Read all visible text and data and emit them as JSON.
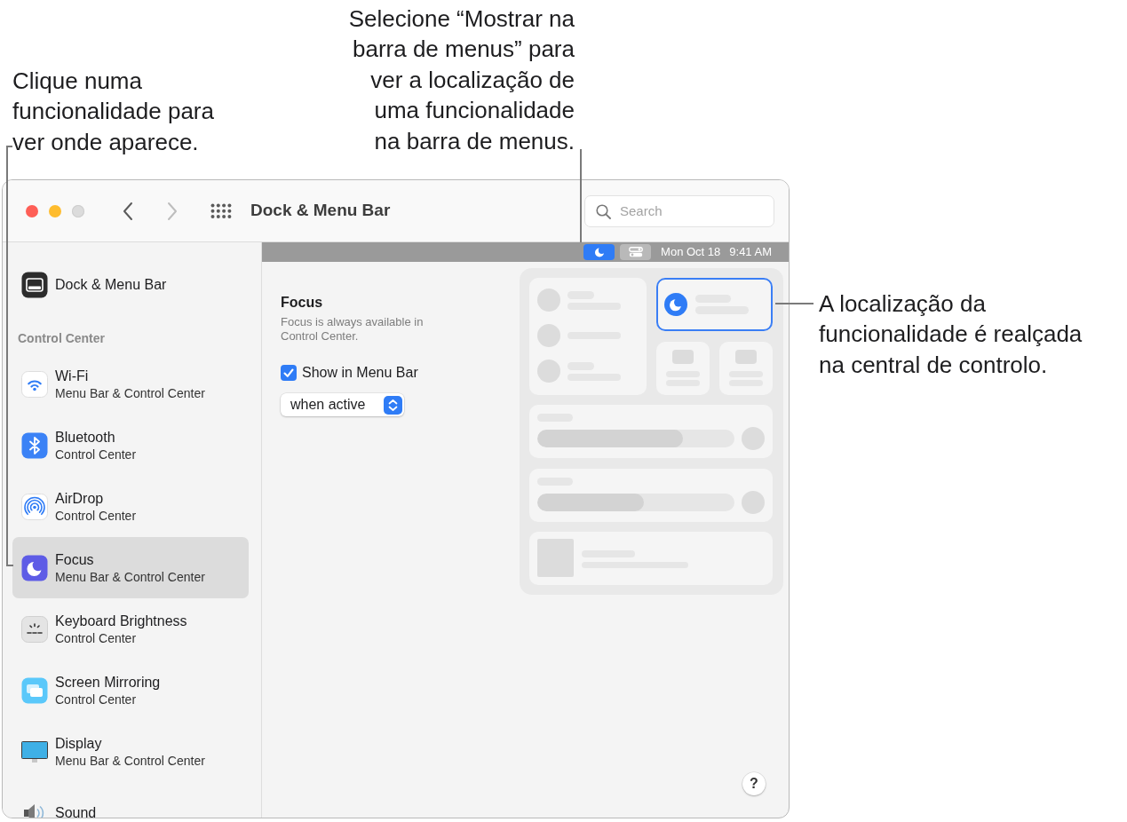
{
  "callouts": [
    {
      "lines": [
        "Clique numa",
        "funcionalidade para",
        "ver onde aparece."
      ]
    },
    {
      "lines": [
        "Selecione “Mostrar na",
        "barra de menus” para",
        "ver a localização de",
        "uma funcionalidade",
        "na barra de menus."
      ]
    },
    {
      "lines": [
        "A localização da",
        "funcionalidade é realçada",
        "na central de controlo."
      ]
    }
  ],
  "window_controls": [
    {
      "kind": "close",
      "disabled": false
    },
    {
      "kind": "minimize",
      "disabled": false
    },
    {
      "kind": "zoom",
      "disabled": true
    }
  ],
  "toolbar": {
    "nav_buttons": [
      {
        "kind": "back",
        "disabled": false
      },
      {
        "kind": "forward",
        "disabled": true
      }
    ],
    "title": "Dock & Menu Bar",
    "search": {
      "placeholder": "Search"
    }
  },
  "sidebar": {
    "top_items": [
      {
        "title": "Dock & Menu Bar",
        "selected": false
      }
    ],
    "section_heading": "Control Center",
    "items": [
      {
        "title": "Wi-Fi",
        "subtitle": "Menu Bar & Control Center",
        "selected": false
      },
      {
        "title": "Bluetooth",
        "subtitle": "Control Center",
        "selected": false
      },
      {
        "title": "AirDrop",
        "subtitle": "Control Center",
        "selected": false
      },
      {
        "title": "Focus",
        "subtitle": "Menu Bar & Control Center",
        "selected": true
      },
      {
        "title": "Keyboard Brightness",
        "subtitle": "Control Center",
        "selected": false
      },
      {
        "title": "Screen Mirroring",
        "subtitle": "Control Center",
        "selected": false
      },
      {
        "title": "Display",
        "subtitle": "Menu Bar & Control Center",
        "selected": false
      },
      {
        "title": "Sound",
        "selected": false
      }
    ]
  },
  "menu_bar_preview": {
    "items": [
      {
        "kind": "focus",
        "highlighted": true
      },
      {
        "kind": "control_center",
        "highlighted": false
      }
    ],
    "date": "Mon Oct 18",
    "time": "9:41 AM"
  },
  "focus_panel": {
    "title": "Focus",
    "description": "Focus is always available in Control Center.",
    "show_in_menu_bar": {
      "label": "Show in Menu Bar",
      "checked": true
    },
    "popup": {
      "value": "when active"
    }
  },
  "control_center_preview": {
    "tiles": [
      {
        "kind": "list",
        "highlighted": false
      },
      {
        "kind": "module",
        "highlighted": true
      },
      {
        "kind": "small",
        "highlighted": false
      },
      {
        "kind": "small",
        "highlighted": false
      },
      {
        "kind": "slider",
        "highlighted": false,
        "level": 0.74
      },
      {
        "kind": "slider",
        "highlighted": false,
        "level": 0.54
      },
      {
        "kind": "media",
        "highlighted": false
      }
    ]
  },
  "help_button": {
    "label": "?"
  }
}
